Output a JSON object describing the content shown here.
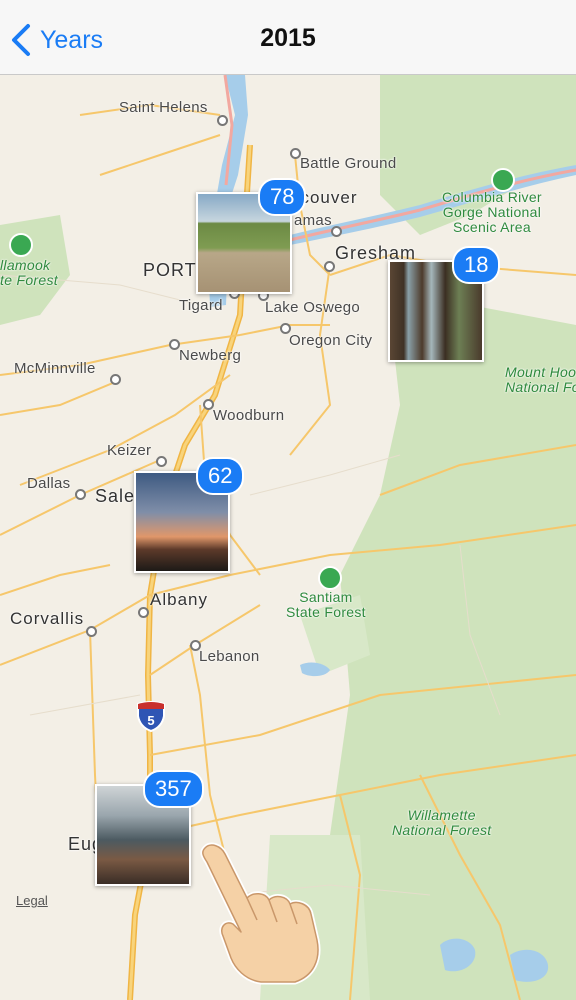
{
  "navbar": {
    "back_label": "Years",
    "title": "2015"
  },
  "map": {
    "cities": {
      "saint_helens": "Saint Helens",
      "battle_ground": "Battle Ground",
      "vancouver": "ncouver",
      "clackamas": "amas",
      "gresham": "Gresham",
      "portland": "PORT",
      "tigard": "Tigard",
      "lake_oswego": "Lake Oswego",
      "oregon_city": "Oregon City",
      "mcminnville": "McMinnville",
      "newberg": "Newberg",
      "woodburn": "Woodburn",
      "keizer": "Keizer",
      "dallas": "Dallas",
      "salem": "Sale",
      "albany": "Albany",
      "corvallis": "Corvallis",
      "lebanon": "Lebanon",
      "eugene": "Eug"
    },
    "forests": {
      "columbia_river": "Columbia River Gorge National Scenic Area",
      "columbia_line1": "Columbia River",
      "columbia_line2": "Gorge National",
      "columbia_line3": "Scenic Area",
      "tillamook_line1": "llamook",
      "tillamook_line2": "te Forest",
      "mount_hood_line1": "Mount Hoo",
      "mount_hood_line2": "National Fo",
      "santiam_line1": "Santiam",
      "santiam_line2": "State Forest",
      "willamette_line1": "Willamette",
      "willamette_line2": "National Forest"
    },
    "highway_shield": "5",
    "legal": "Legal"
  },
  "clusters": [
    {
      "count": "78"
    },
    {
      "count": "18"
    },
    {
      "count": "62"
    },
    {
      "count": "357"
    }
  ],
  "colors": {
    "accent": "#1a7cf5",
    "forest": "#cfe3bc",
    "road": "#f6c76b",
    "water": "#a6cdea"
  }
}
